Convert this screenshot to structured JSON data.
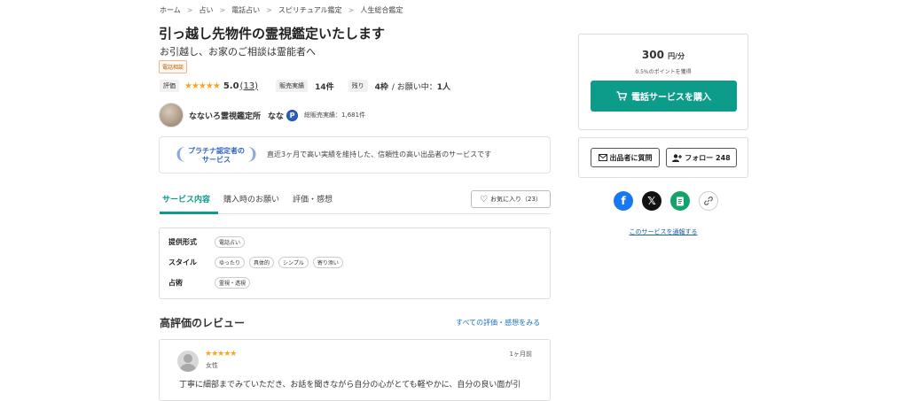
{
  "breadcrumb": [
    "ホーム",
    "占い",
    "電話占い",
    "スピリチュアル鑑定",
    "人生総合鑑定"
  ],
  "breadcrumb_sep": ">",
  "title": "引っ越し先物件の霊視鑑定いたします",
  "subtitle": "お引越し、お家のご相談は霊能者へ",
  "tag": "電話相談",
  "stats": {
    "rating_label": "評価",
    "stars": "★★★★★",
    "rating": "5.0",
    "rating_count": "(13)",
    "sales_label": "販売実績",
    "sales_value": "14件",
    "remaining_label": "残り",
    "remaining_value": "4枠",
    "in_progress": "/ お願い中：",
    "in_progress_value": "1人"
  },
  "seller": {
    "name": "なないろ霊視鑑定所",
    "nickname": "なな",
    "badge": "P",
    "total_sales": "総販売実績：1,681件"
  },
  "platinum": {
    "badge_line1": "プラチナ認定者の",
    "badge_line2": "サービス",
    "text": "直近3ヶ月で高い実績を維持した、信頼性の高い出品者のサービスです"
  },
  "tabs": [
    "サービス内容",
    "購入時のお願い",
    "評価・感想"
  ],
  "favorite": {
    "icon": "♡",
    "label": "お気に入り（23）"
  },
  "spec": {
    "rows": [
      {
        "label": "提供形式",
        "values": [
          "電話占い"
        ]
      },
      {
        "label": "スタイル",
        "values": [
          "ゆったり",
          "具体的",
          "シンプル",
          "寄り添い"
        ]
      },
      {
        "label": "占術",
        "values": [
          "霊視・透視"
        ]
      }
    ]
  },
  "reviews": {
    "title": "高評価のレビュー",
    "see_all": "すべての評価・感想をみる",
    "items": [
      {
        "stars": "★★★★★",
        "gender": "女性",
        "time": "1ヶ月前",
        "text": "丁寧に細部までみていただき、お話を聞きながら自分の心がとても軽やかに、自分の良い面が引"
      }
    ]
  },
  "purchase": {
    "price": "300",
    "unit": "円/分",
    "points": "0.5%のポイントを獲得",
    "buy_label": "電話サービスを購入"
  },
  "follow": {
    "ask_label": "出品者に質問",
    "follow_label": "フォロー 248"
  },
  "share": {
    "facebook_color": "#1877f2",
    "x_color": "#111111",
    "hatena_color": "#14a46b"
  },
  "report_label": "このサービスを通報する",
  "colors": {
    "accent": "#0e9c8a",
    "link": "#1a73c7",
    "star": "#f5a623"
  }
}
